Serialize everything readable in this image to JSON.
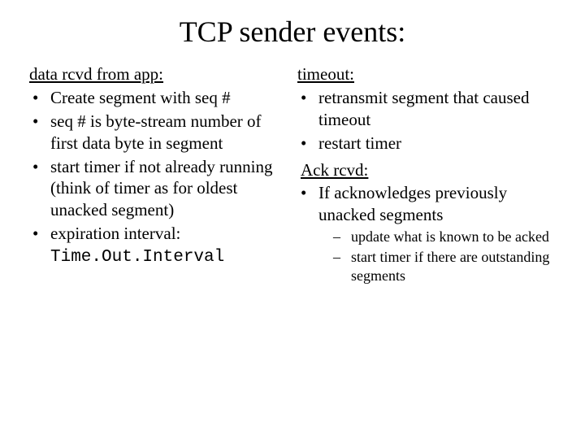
{
  "title": "TCP sender events:",
  "left": {
    "heading": "data rcvd from app:",
    "b1": "Create segment with seq #",
    "b2": "seq # is byte-stream number of first data byte in  segment",
    "b3": "start timer if not already running (think of timer as for oldest unacked segment)",
    "b4_prefix": "expiration interval: ",
    "b4_code": "Time.Out.Interval"
  },
  "right": {
    "heading1": "timeout:",
    "b1": "retransmit segment that caused timeout",
    "b2": "restart timer",
    "heading2": "Ack rcvd:",
    "b3": "If acknowledges previously unacked segments",
    "s1": "update what is known to be acked",
    "s2": "start timer if there are outstanding segments"
  }
}
